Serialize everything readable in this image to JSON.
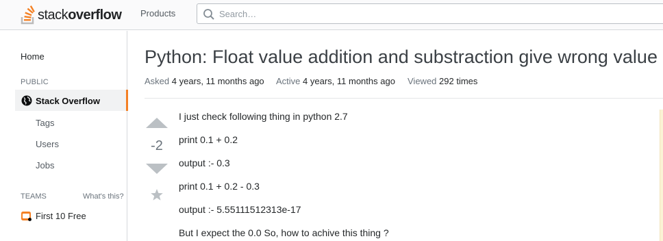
{
  "header": {
    "logo": {
      "text_light": "stack",
      "text_bold": "overflow",
      "icon": "stackoverflow-logo-icon"
    },
    "products_label": "Products",
    "search": {
      "placeholder": "Search…",
      "icon": "search-icon"
    }
  },
  "sidebar": {
    "home": "Home",
    "public_heading": "PUBLIC",
    "stackoverflow": {
      "label": "Stack Overflow",
      "icon": "globe-icon"
    },
    "items": [
      {
        "label": "Tags"
      },
      {
        "label": "Users"
      },
      {
        "label": "Jobs"
      }
    ],
    "teams_heading": "TEAMS",
    "whats_this": "What's this?",
    "teams_free": {
      "label": "First 10 Free",
      "icon": "briefcase-icon"
    }
  },
  "question": {
    "title": "Python: Float value addition and substraction give wrong value",
    "meta": {
      "asked_label": "Asked",
      "asked_value": "4 years, 11 months ago",
      "active_label": "Active",
      "active_value": "4 years, 11 months ago",
      "viewed_label": "Viewed",
      "viewed_value": "292 times"
    },
    "vote_count": "-2",
    "body": [
      "I just check following thing in python 2.7",
      "print 0.1 + 0.2",
      "output :- 0.3",
      "print 0.1 + 0.2 - 0.3",
      "output :- 5.55111512313e-17",
      "But I expect the 0.0 So, how to achive this thing ?"
    ]
  },
  "colors": {
    "accent": "#f48024",
    "link_gray": "#6a737c",
    "text": "#242729",
    "border": "#d6d9dc"
  }
}
